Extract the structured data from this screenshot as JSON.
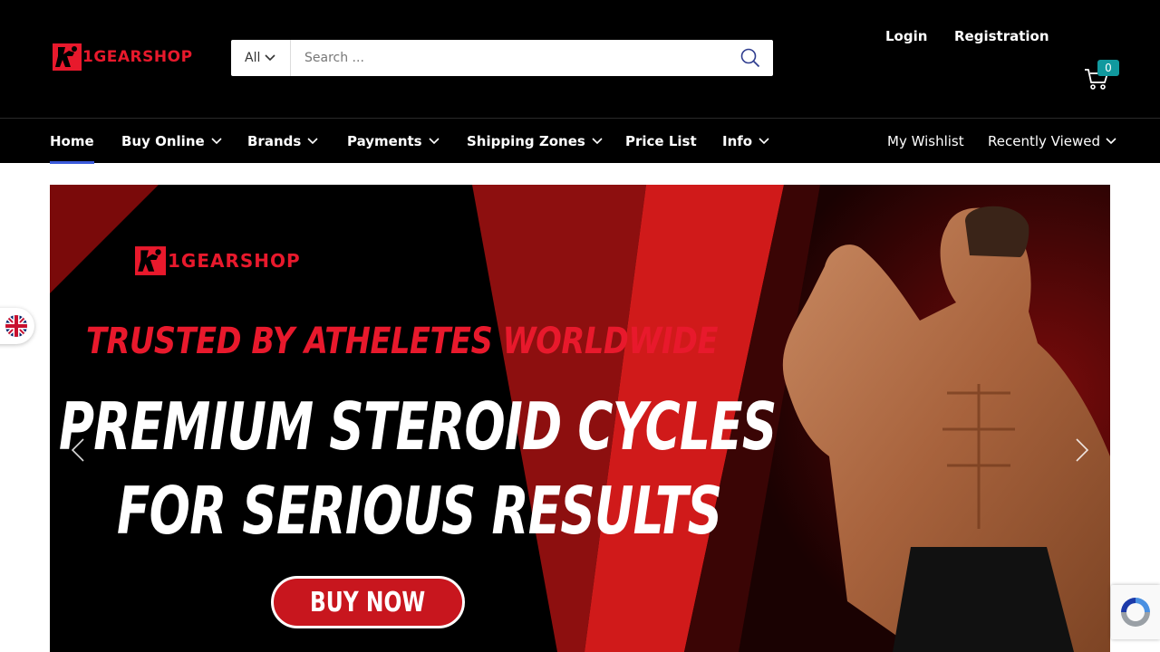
{
  "header": {
    "logo_text": "1GEARSHOP",
    "search": {
      "category": "All",
      "placeholder": "Search ..."
    },
    "login_label": "Login",
    "register_label": "Registration",
    "cart_count": "0"
  },
  "nav": {
    "items": [
      {
        "label": "Home"
      },
      {
        "label": "Buy Online"
      },
      {
        "label": "Brands"
      },
      {
        "label": "Payments"
      },
      {
        "label": "Shipping Zones"
      },
      {
        "label": "Price List"
      },
      {
        "label": "Info"
      }
    ],
    "right": [
      {
        "label": "My Wishlist"
      },
      {
        "label": "Recently Viewed"
      }
    ]
  },
  "hero": {
    "logo_text": "1GEARSHOP",
    "tagline": "TRUSTED BY ATHELETES WORLDWIDE",
    "headline_line1": "PREMIUM STEROID CYCLES",
    "headline_line2": "FOR SERIOUS RESULTS",
    "cta_label": "BUY NOW"
  },
  "colors": {
    "brand_red": "#e8192c",
    "header_bg": "#000000",
    "cart_badge": "#11999e",
    "active_underline": "#3b5bdb"
  },
  "icons": [
    "search-icon",
    "cart-icon",
    "chevron-down-icon",
    "chevron-left-icon",
    "chevron-right-icon",
    "uk-flag-icon",
    "recaptcha-icon"
  ]
}
